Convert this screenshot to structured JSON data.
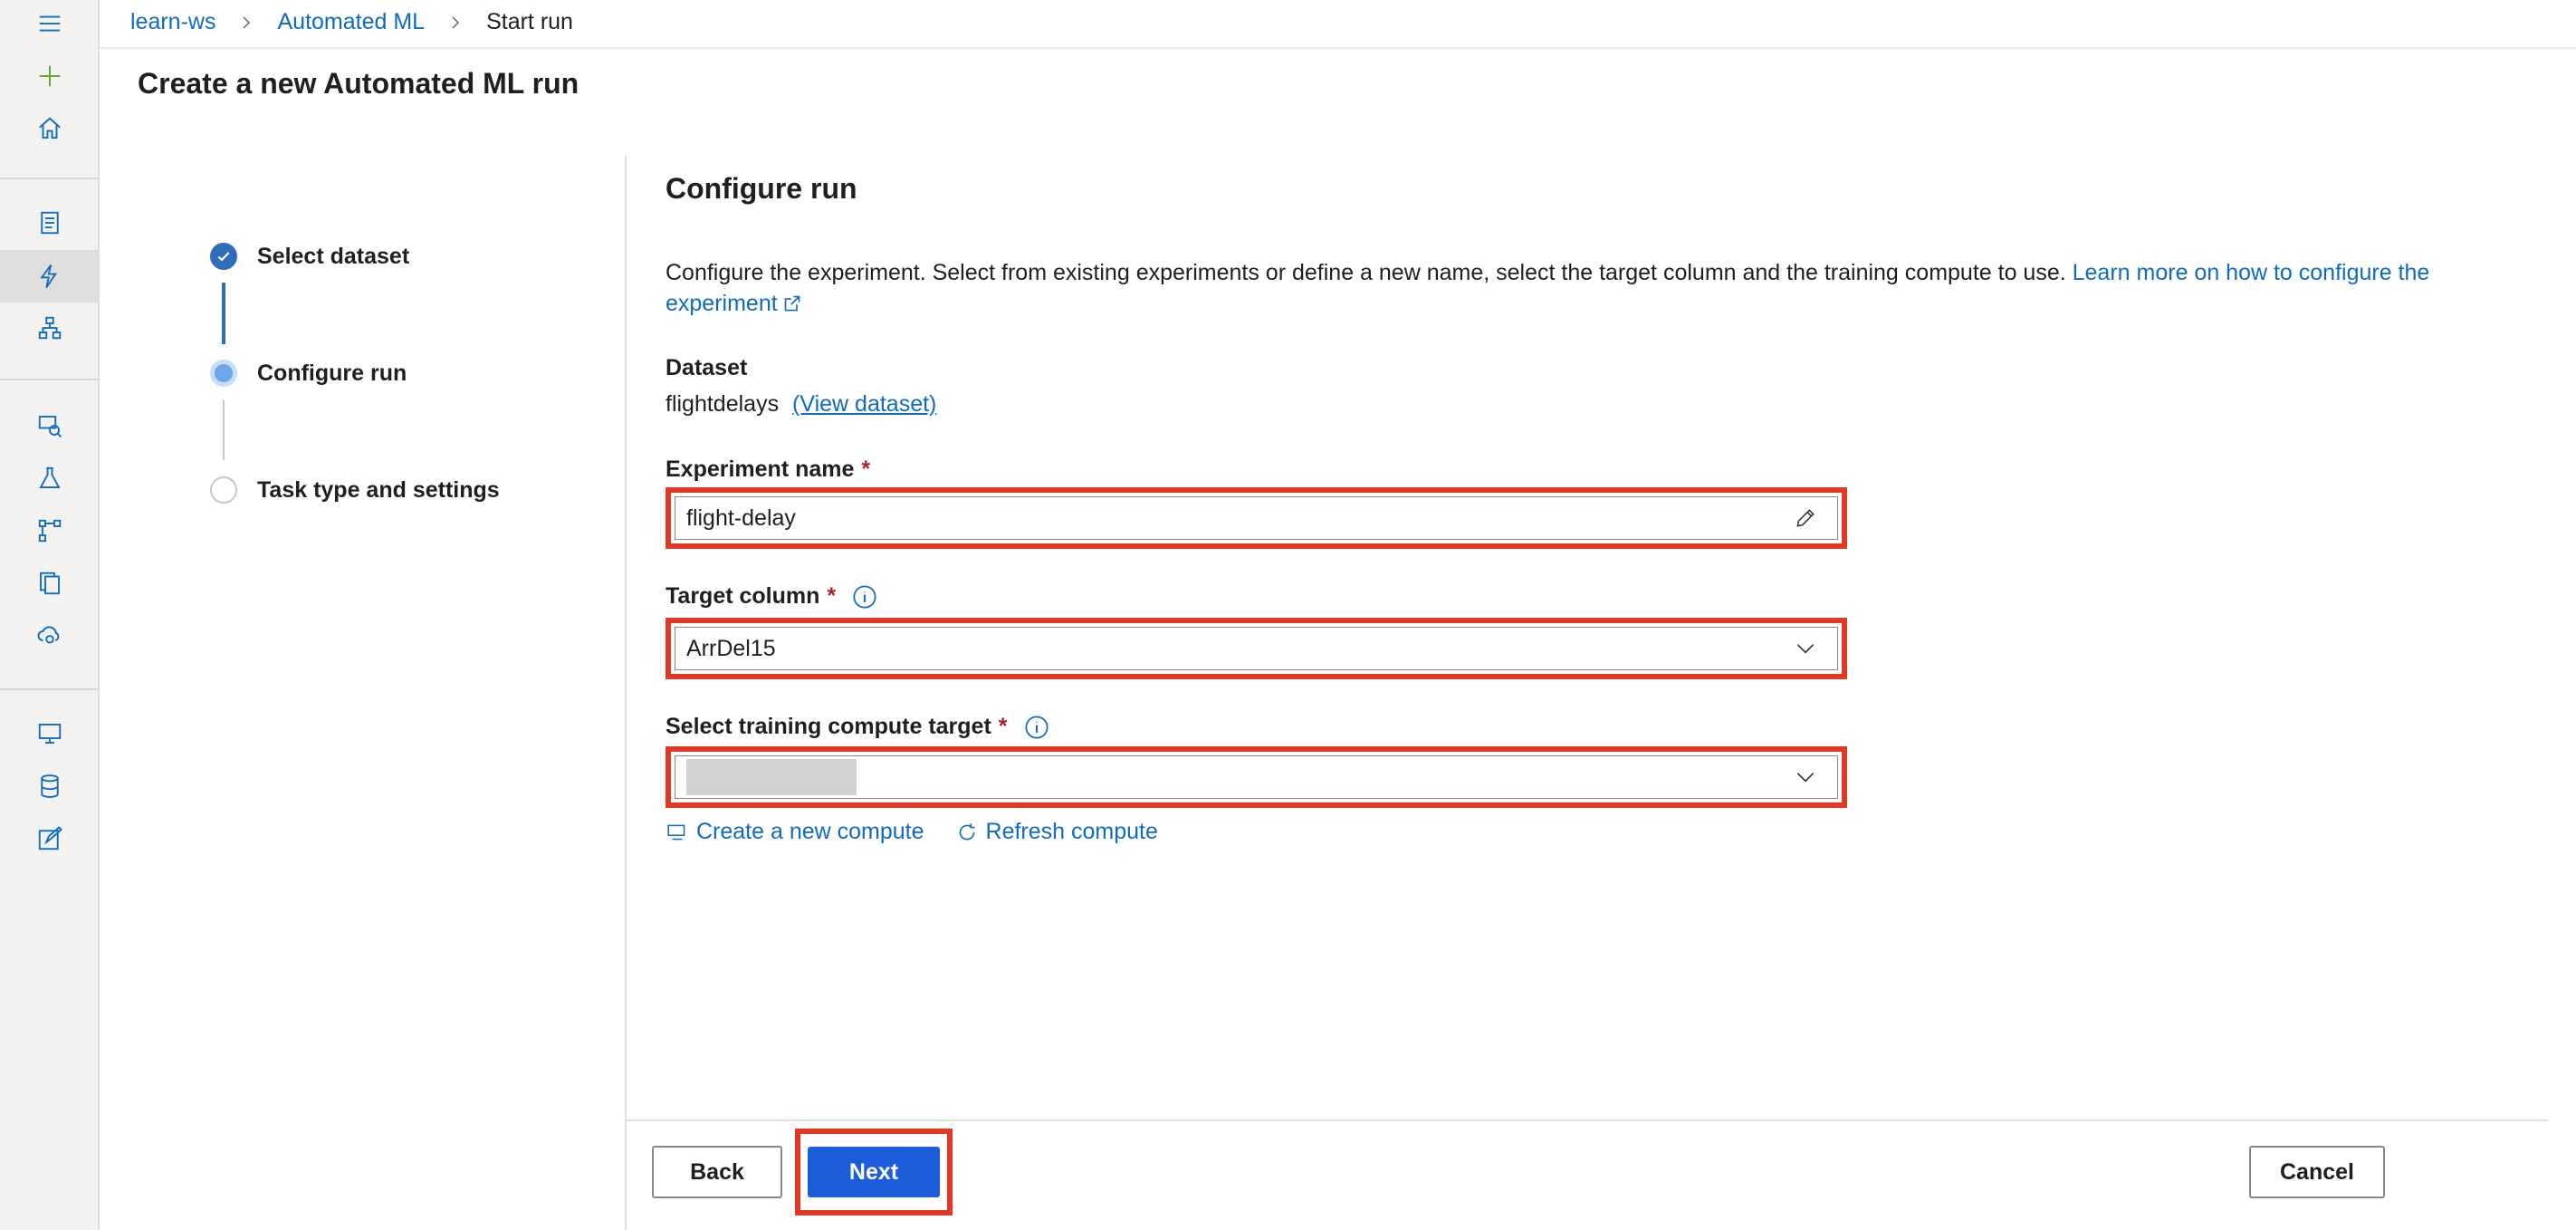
{
  "breadcrumb": {
    "items": [
      "learn-ws",
      "Automated ML"
    ],
    "current": "Start run"
  },
  "page_title": "Create a new Automated ML run",
  "stepper": {
    "steps": [
      {
        "label": "Select dataset",
        "state": "done"
      },
      {
        "label": "Configure run",
        "state": "current"
      },
      {
        "label": "Task type and settings",
        "state": "todo"
      }
    ]
  },
  "form": {
    "heading": "Configure run",
    "description": "Configure the experiment. Select from existing experiments or define a new name, select the target column and the training compute to use.",
    "learn_more_link": "Learn more on how to configure the experiment",
    "dataset_label": "Dataset",
    "dataset_value": "flightdelays",
    "view_dataset_link": "(View dataset)",
    "experiment_label": "Experiment name",
    "experiment_value": "flight-delay",
    "target_label": "Target column",
    "target_value": "ArrDel15",
    "compute_label": "Select training compute target",
    "compute_value": "",
    "required_marker": "*",
    "create_compute_link": "Create a new compute",
    "refresh_compute_link": "Refresh compute"
  },
  "footer": {
    "back_label": "Back",
    "next_label": "Next",
    "cancel_label": "Cancel"
  },
  "colors": {
    "accent": "#0f6cbd",
    "primary_button": "#1d5dd9",
    "highlight_frame": "#e03a25",
    "required": "#a4262c"
  },
  "icons": {
    "rail": [
      "hamburger-icon",
      "plus-icon",
      "home-icon",
      "notebook-icon",
      "automl-icon",
      "designer-icon",
      "datasets-icon",
      "experiments-icon",
      "pipelines-icon",
      "models-icon",
      "endpoints-icon",
      "compute-icon",
      "datastores-icon",
      "data-labeling-icon"
    ]
  }
}
